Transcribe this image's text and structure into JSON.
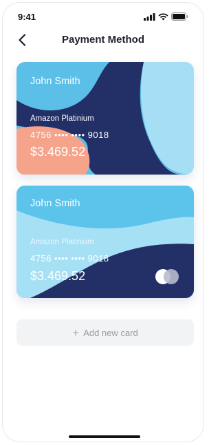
{
  "status_bar": {
    "time": "9:41",
    "icons": [
      "signal-icon",
      "wifi-icon",
      "battery-icon"
    ]
  },
  "nav": {
    "title": "Payment Method",
    "back_icon": "back-arrow-icon"
  },
  "cards": [
    {
      "holder": "John Smith",
      "type": "Amazon Platinium",
      "number": "4756 •••• •••• 9018",
      "balance": "$3.469.52",
      "colors": {
        "base": "#a6dff5",
        "wave": "#5bbfe8",
        "dark": "#233067",
        "accent": "#f6a38b"
      }
    },
    {
      "holder": "John Smith",
      "type": "Amazon Platinium",
      "number": "4756 •••• •••• 9018",
      "balance": "$3.469.52",
      "colors": {
        "base": "#5cc3ea",
        "wave": "#a6e0f5",
        "dark": "#233067"
      }
    }
  ],
  "add_card": {
    "label": "Add new card",
    "icon": "plus-icon"
  }
}
